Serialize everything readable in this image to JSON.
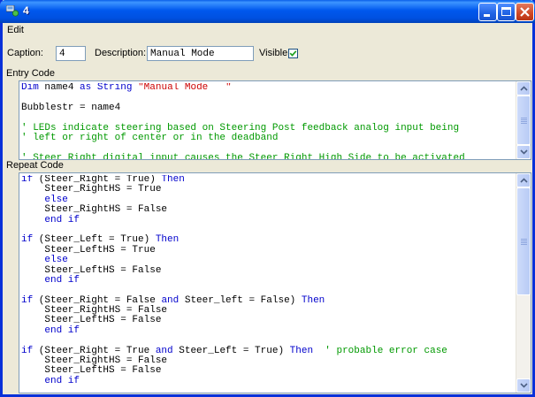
{
  "window": {
    "title": "4"
  },
  "menu": {
    "items": [
      "Edit"
    ]
  },
  "form": {
    "caption_label": "Caption:",
    "caption_value": "4",
    "description_label": "Description:",
    "description_value": "Manual Mode",
    "visible_label": "Visible",
    "visible_checked": true
  },
  "entry": {
    "label": "Entry Code",
    "lines": [
      [
        [
          "kw",
          "Dim"
        ],
        [
          "pl",
          " name4 "
        ],
        [
          "kw",
          "as"
        ],
        [
          "pl",
          " "
        ],
        [
          "kw",
          "String"
        ],
        [
          "pl",
          " "
        ],
        [
          "st",
          "\"Manual Mode   \""
        ]
      ],
      [],
      [
        [
          "pl",
          "Bubblestr = name4"
        ]
      ],
      [],
      [
        [
          "cm",
          "' LEDs indicate steering based on Steering Post feedback analog input being"
        ]
      ],
      [
        [
          "cm",
          "' left or right of center or in the deadband"
        ]
      ],
      [],
      [
        [
          "cm",
          "' Steer Right digital input causes the Steer Right High Side to be activated"
        ]
      ]
    ]
  },
  "repeat": {
    "label": "Repeat Code",
    "lines": [
      [
        [
          "kw",
          "if"
        ],
        [
          "pl",
          " (Steer_Right = True) "
        ],
        [
          "kw",
          "Then"
        ]
      ],
      [
        [
          "pl",
          "    Steer_RightHS = True"
        ]
      ],
      [
        [
          "kw",
          "    else"
        ]
      ],
      [
        [
          "pl",
          "    Steer_RightHS = False"
        ]
      ],
      [
        [
          "kw",
          "    end if"
        ]
      ],
      [],
      [
        [
          "kw",
          "if"
        ],
        [
          "pl",
          " (Steer_Left = True) "
        ],
        [
          "kw",
          "Then"
        ]
      ],
      [
        [
          "pl",
          "    Steer_LeftHS = True"
        ]
      ],
      [
        [
          "kw",
          "    else"
        ]
      ],
      [
        [
          "pl",
          "    Steer_LeftHS = False"
        ]
      ],
      [
        [
          "kw",
          "    end if"
        ]
      ],
      [],
      [
        [
          "kw",
          "if"
        ],
        [
          "pl",
          " (Steer_Right = False "
        ],
        [
          "kw",
          "and"
        ],
        [
          "pl",
          " Steer_left = False) "
        ],
        [
          "kw",
          "Then"
        ]
      ],
      [
        [
          "pl",
          "    Steer_RightHS = False"
        ]
      ],
      [
        [
          "pl",
          "    Steer_LeftHS = False"
        ]
      ],
      [
        [
          "kw",
          "    end if"
        ]
      ],
      [],
      [
        [
          "kw",
          "if"
        ],
        [
          "pl",
          " (Steer_Right = True "
        ],
        [
          "kw",
          "and"
        ],
        [
          "pl",
          " Steer_Left = True) "
        ],
        [
          "kw",
          "Then"
        ],
        [
          "pl",
          "  "
        ],
        [
          "cm",
          "' probable error case"
        ]
      ],
      [
        [
          "pl",
          "    Steer_RightHS = False"
        ]
      ],
      [
        [
          "pl",
          "    Steer_LeftHS = False"
        ]
      ],
      [
        [
          "kw",
          "    end if"
        ]
      ]
    ]
  }
}
